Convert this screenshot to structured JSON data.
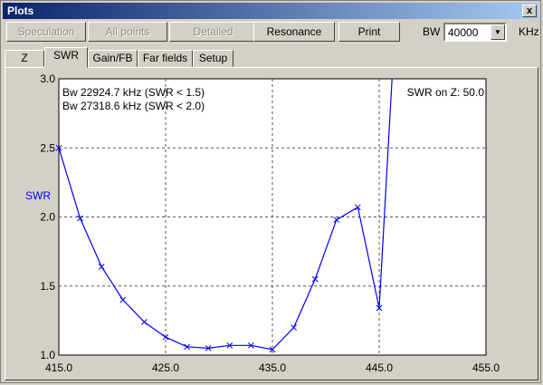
{
  "window": {
    "title": "Plots",
    "close_glyph": "x"
  },
  "toolbar": {
    "speculation": "Speculation",
    "all_points": "All points",
    "detailed": "Detailed",
    "resonance": "Resonance",
    "print": "Print",
    "bw_label": "BW",
    "bw_value": "40000",
    "bw_unit": "KHz"
  },
  "tabs": [
    "Z",
    "SWR",
    "Gain/FB",
    "Far fields",
    "Setup"
  ],
  "active_tab": "SWR",
  "chart_data": {
    "type": "line",
    "ylabel": "SWR",
    "xlim": [
      415,
      455
    ],
    "ylim": [
      1.0,
      3.0
    ],
    "x_ticks": [
      "415.0",
      "425.0",
      "435.0",
      "445.0",
      "455.0"
    ],
    "y_ticks": [
      "1.0",
      "1.5",
      "2.0",
      "2.5",
      "3.0"
    ],
    "grid": true,
    "series_color": "#0000ff",
    "annotations": {
      "bw_line1": "Bw 22924.7 kHz (SWR < 1.5)",
      "bw_line2": "Bw 27318.6 kHz (SWR < 2.0)",
      "swr_on_z": "SWR on Z: 50.0"
    },
    "series": [
      {
        "x": [
          415,
          417,
          419,
          421,
          423,
          425,
          427,
          429,
          431,
          433,
          435,
          437,
          439,
          441,
          443,
          445,
          446.2
        ],
        "y": [
          2.5,
          1.99,
          1.64,
          1.4,
          1.24,
          1.13,
          1.06,
          1.05,
          1.07,
          1.07,
          1.04,
          1.2,
          1.55,
          1.98,
          2.07,
          1.34,
          3.0
        ]
      }
    ]
  }
}
